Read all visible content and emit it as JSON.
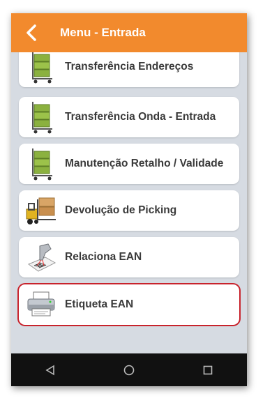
{
  "header": {
    "title": "Menu - Entrada"
  },
  "menu": {
    "items": [
      {
        "label": "Transferência Endereços",
        "icon": "cart-boxes-icon"
      },
      {
        "label": "Transferência Onda - Entrada",
        "icon": "cart-boxes-icon"
      },
      {
        "label": "Manutenção Retalho / Validade",
        "icon": "cart-boxes-icon"
      },
      {
        "label": "Devolução de Picking",
        "icon": "forklift-icon"
      },
      {
        "label": "Relaciona EAN",
        "icon": "barcode-scanner-icon"
      },
      {
        "label": "Etiqueta EAN",
        "icon": "printer-icon",
        "selected": true
      }
    ]
  },
  "colors": {
    "appbar": "#f28a2d",
    "highlight": "#c8232c",
    "background": "#d6dbe2"
  }
}
